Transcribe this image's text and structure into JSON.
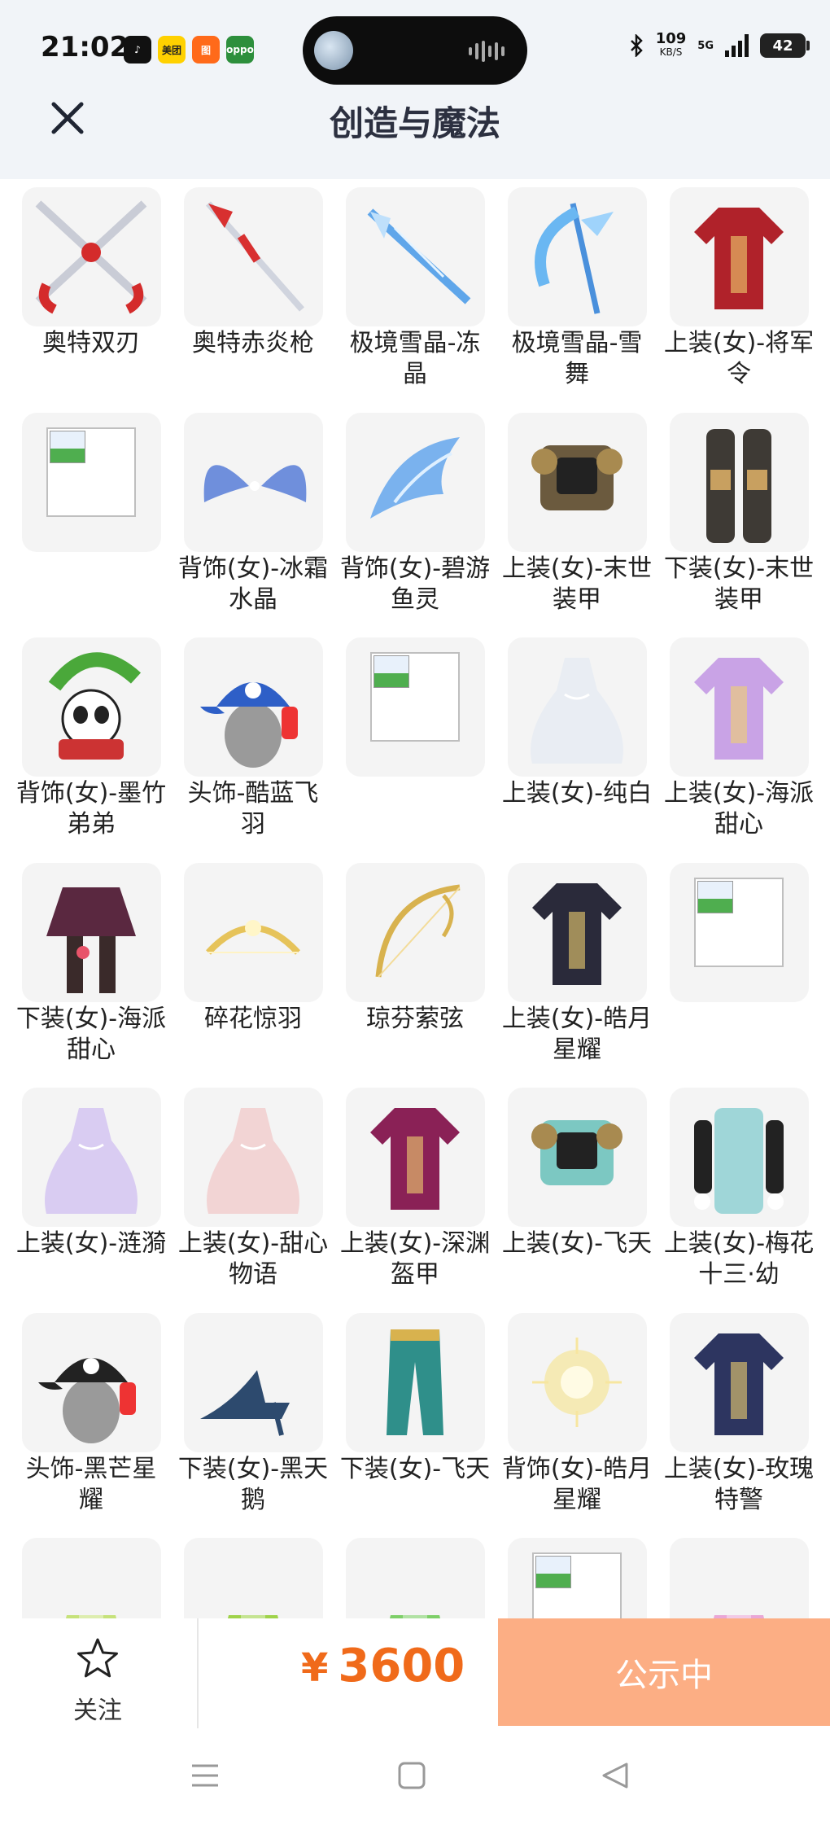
{
  "status": {
    "time": "21:02",
    "app_icons": [
      {
        "name": "tiktok-icon",
        "label": "♪",
        "color": "#111111"
      },
      {
        "name": "meituan-icon",
        "label": "美团",
        "color": "#ffd100"
      },
      {
        "name": "taobao-icon",
        "label": "图",
        "color": "#ff6a1a"
      },
      {
        "name": "oppo-icon",
        "label": "oppo",
        "color": "#2d8f3c"
      }
    ],
    "speed_value": "109",
    "speed_unit": "KB/S",
    "network": "5G",
    "battery": "42"
  },
  "header": {
    "title": "创造与魔法"
  },
  "items": [
    {
      "label": "奥特双刃",
      "icon": "twin-blades-icon",
      "kind": "blades"
    },
    {
      "label": "奥特赤炎枪",
      "icon": "spear-icon",
      "kind": "spear"
    },
    {
      "label": "极境雪晶-冻晶",
      "icon": "ice-sword-icon",
      "kind": "icesword"
    },
    {
      "label": "极境雪晶-雪舞",
      "icon": "ice-scythe-icon",
      "kind": "icescythe"
    },
    {
      "label": "上装(女)-将军令",
      "icon": "red-outfit-icon",
      "kind": "outfit",
      "color": "#b0222a"
    },
    {
      "label": "",
      "icon": "broken-image-icon",
      "kind": "broken"
    },
    {
      "label": "背饰(女)-冰霜水晶",
      "icon": "ice-wings-icon",
      "kind": "wings",
      "color": "#6f8fdc"
    },
    {
      "label": "背饰(女)-碧游鱼灵",
      "icon": "water-wings-icon",
      "kind": "fin",
      "color": "#7ab2ee"
    },
    {
      "label": "上装(女)-末世装甲",
      "icon": "armor-top-icon",
      "kind": "armor",
      "color": "#6b5a3e"
    },
    {
      "label": "下装(女)-末世装甲",
      "icon": "armor-legs-icon",
      "kind": "legs",
      "color": "#3e3a35"
    },
    {
      "label": "背饰(女)-墨竹弟弟",
      "icon": "panda-icon",
      "kind": "panda"
    },
    {
      "label": "头饰-酷蓝飞羽",
      "icon": "blue-cap-icon",
      "kind": "cap",
      "color": "#2e5fc7"
    },
    {
      "label": "",
      "icon": "broken-image-icon",
      "kind": "broken"
    },
    {
      "label": "上装(女)-纯白",
      "icon": "white-dress-icon",
      "kind": "dress",
      "color": "#e9edf3"
    },
    {
      "label": "上装(女)-海派甜心",
      "icon": "gold-top-icon",
      "kind": "outfit",
      "color": "#c9a3e6"
    },
    {
      "label": "下装(女)-海派甜心",
      "icon": "skirt-icon",
      "kind": "skirt",
      "color": "#5a2840"
    },
    {
      "label": "碎花惊羽",
      "icon": "gold-bow-icon",
      "kind": "bow",
      "color": "#e6c35a"
    },
    {
      "label": "琼芬萦弦",
      "icon": "gold-harp-icon",
      "kind": "harp",
      "color": "#d8b24e"
    },
    {
      "label": "上装(女)-皓月星耀",
      "icon": "dark-top-icon",
      "kind": "outfit",
      "color": "#2a2a3a"
    },
    {
      "label": "",
      "icon": "broken-image-icon",
      "kind": "broken"
    },
    {
      "label": "上装(女)-涟漪",
      "icon": "lavender-dress-icon",
      "kind": "dress",
      "color": "#d9ccf2"
    },
    {
      "label": "上装(女)-甜心物语",
      "icon": "heart-dress-icon",
      "kind": "dress",
      "color": "#f2d4d4"
    },
    {
      "label": "上装(女)-深渊盔甲",
      "icon": "abyss-armor-icon",
      "kind": "outfit",
      "color": "#8a2156"
    },
    {
      "label": "上装(女)-飞天",
      "icon": "feitian-top-icon",
      "kind": "armor",
      "color": "#7cc8c2"
    },
    {
      "label": "上装(女)-梅花十三·幼",
      "icon": "teal-coat-icon",
      "kind": "coat",
      "color": "#9fd6d8"
    },
    {
      "label": "头饰-黑芒星耀",
      "icon": "black-cap-icon",
      "kind": "cap",
      "color": "#222222"
    },
    {
      "label": "下装(女)-黑天鹅",
      "icon": "heels-icon",
      "kind": "heels",
      "color": "#2d4a6e"
    },
    {
      "label": "下装(女)-飞天",
      "icon": "teal-pants-icon",
      "kind": "pants",
      "color": "#2f8f8a"
    },
    {
      "label": "背饰(女)-皓月星耀",
      "icon": "glow-orb-icon",
      "kind": "orb",
      "color": "#f5e69a"
    },
    {
      "label": "上装(女)-玫瑰特警",
      "icon": "navy-uniform-icon",
      "kind": "outfit",
      "color": "#2d3560"
    },
    {
      "label": "",
      "icon": "green-boots-icon",
      "kind": "partial",
      "color": "#c6e27a"
    },
    {
      "label": "",
      "icon": "green-dress-icon",
      "kind": "partial",
      "color": "#9fd34a"
    },
    {
      "label": "",
      "icon": "green-armor-icon",
      "kind": "partial",
      "color": "#7dcf68"
    },
    {
      "label": "",
      "icon": "broken-image-icon",
      "kind": "broken"
    },
    {
      "label": "",
      "icon": "pink-dress-icon",
      "kind": "partial",
      "color": "#e9a7d6"
    }
  ],
  "actions": {
    "follow_label": "关注",
    "currency": "¥",
    "price": "3600",
    "status_button": "公示中"
  }
}
